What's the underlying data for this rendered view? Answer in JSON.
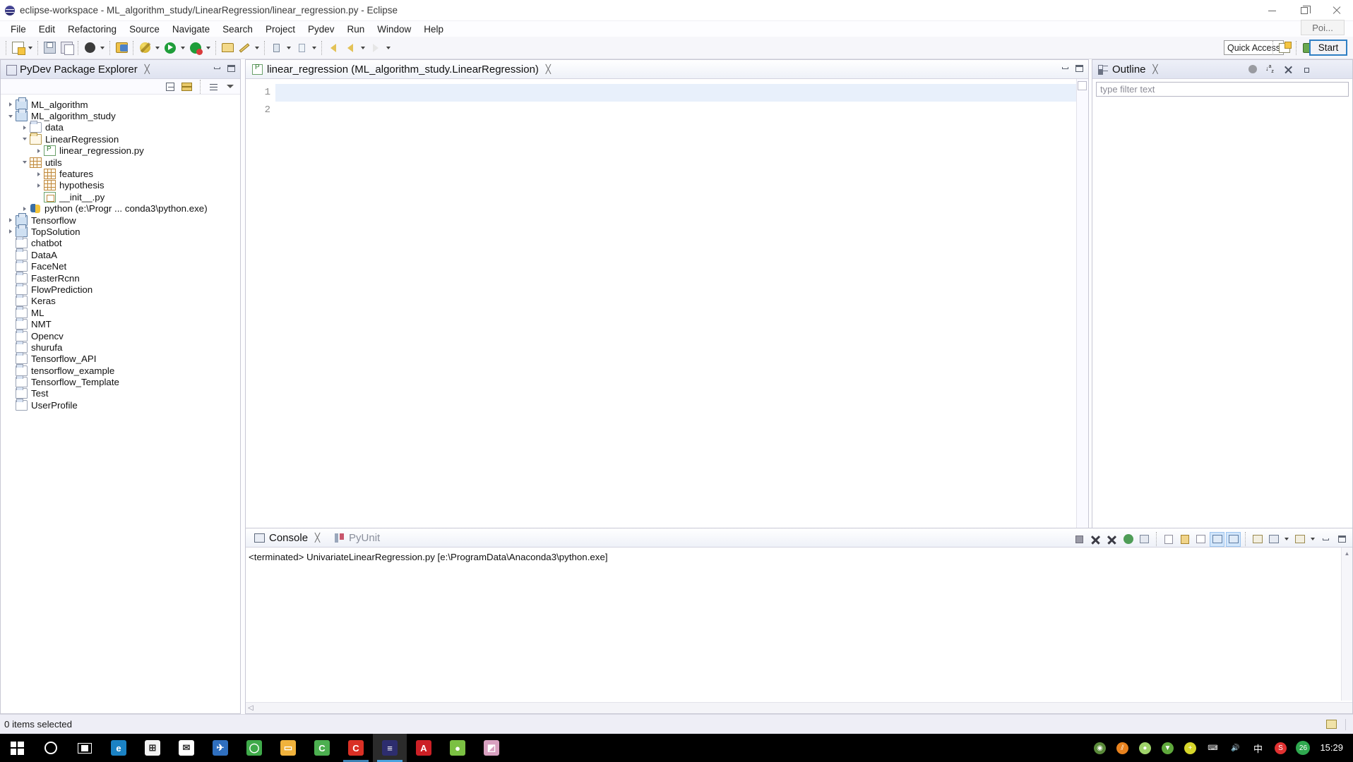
{
  "window": {
    "title": "eclipse-workspace - ML_algorithm_study/LinearRegression/linear_regression.py - Eclipse",
    "minimize_label": "Minimize",
    "restore_label": "Restore",
    "close_label": "Close"
  },
  "menubar": [
    {
      "label": "File"
    },
    {
      "label": "Edit"
    },
    {
      "label": "Refactoring"
    },
    {
      "label": "Source"
    },
    {
      "label": "Navigate"
    },
    {
      "label": "Search"
    },
    {
      "label": "Project"
    },
    {
      "label": "Pydev"
    },
    {
      "label": "Run"
    },
    {
      "label": "Window"
    },
    {
      "label": "Help"
    }
  ],
  "toolbar": {
    "quick_access_placeholder": "Quick Access",
    "buttons": [
      {
        "name": "new-wizard",
        "icon": "new-document-icon"
      },
      {
        "name": "save",
        "icon": "save-icon"
      },
      {
        "name": "save-all",
        "icon": "save-all-icon"
      },
      {
        "name": "toggle-comment",
        "icon": "black-circle-icon"
      },
      {
        "name": "pydev-package",
        "icon": "pydev-package-icon"
      },
      {
        "name": "debug",
        "icon": "debug-bug-icon"
      },
      {
        "name": "run",
        "icon": "run-play-icon"
      },
      {
        "name": "coverage",
        "icon": "coverage-icon"
      },
      {
        "name": "external-tools",
        "icon": "external-tools-icon"
      },
      {
        "name": "search",
        "icon": "search-pencil-icon"
      },
      {
        "name": "next-annotation",
        "icon": "arrow-down-icon"
      },
      {
        "name": "previous-annotation",
        "icon": "arrow-up-icon"
      },
      {
        "name": "back",
        "icon": "back-arrow-icon"
      },
      {
        "name": "forward",
        "icon": "forward-arrow-icon"
      }
    ],
    "perspective_buttons": [
      {
        "name": "open-perspective",
        "icon": "open-perspective-icon"
      },
      {
        "name": "pydev-perspective",
        "icon": "pydev-perspective-icon"
      },
      {
        "name": "debug-perspective",
        "icon": "debug-perspective-icon"
      }
    ]
  },
  "explorer": {
    "title": "PyDev Package Explorer",
    "icon": "package-explorer-icon",
    "toolbar": [
      {
        "name": "collapse-all",
        "icon": "collapse-all-icon"
      },
      {
        "name": "link-with-editor",
        "icon": "link-editor-icon"
      },
      {
        "name": "view-menu-sort",
        "icon": "sort-icon"
      },
      {
        "name": "view-menu",
        "icon": "chevron-down-icon"
      }
    ],
    "tree": [
      {
        "label": "ML_algorithm",
        "icon": "project-icon",
        "indent": 0,
        "twisty": "collapsed"
      },
      {
        "label": "ML_algorithm_study",
        "icon": "project-icon",
        "indent": 0,
        "twisty": "expanded"
      },
      {
        "label": "data",
        "icon": "folder-icon",
        "indent": 1,
        "twisty": "collapsed"
      },
      {
        "label": "LinearRegression",
        "icon": "source-folder-icon",
        "indent": 1,
        "twisty": "expanded"
      },
      {
        "label": "linear_regression.py",
        "icon": "python-file-icon",
        "indent": 2,
        "twisty": "collapsed"
      },
      {
        "label": "utils",
        "icon": "package-icon",
        "indent": 1,
        "twisty": "expanded"
      },
      {
        "label": "features",
        "icon": "package-icon",
        "indent": 2,
        "twisty": "collapsed"
      },
      {
        "label": "hypothesis",
        "icon": "package-icon",
        "indent": 2,
        "twisty": "collapsed"
      },
      {
        "label": "__init__.py",
        "icon": "init-file-icon",
        "indent": 2,
        "twisty": "none"
      },
      {
        "label": "python  (e:\\Progr ... conda3\\python.exe)",
        "icon": "python-interpreter-icon",
        "indent": 1,
        "twisty": "collapsed"
      },
      {
        "label": "Tensorflow",
        "icon": "project-icon",
        "indent": 0,
        "twisty": "collapsed"
      },
      {
        "label": "TopSolution",
        "icon": "project-icon",
        "indent": 0,
        "twisty": "collapsed"
      },
      {
        "label": "chatbot",
        "icon": "folder-icon",
        "indent": 0,
        "twisty": "none"
      },
      {
        "label": "DataA",
        "icon": "folder-icon",
        "indent": 0,
        "twisty": "none"
      },
      {
        "label": "FaceNet",
        "icon": "folder-icon",
        "indent": 0,
        "twisty": "none"
      },
      {
        "label": "FasterRcnn",
        "icon": "folder-icon",
        "indent": 0,
        "twisty": "none"
      },
      {
        "label": "FlowPrediction",
        "icon": "folder-icon",
        "indent": 0,
        "twisty": "none"
      },
      {
        "label": "Keras",
        "icon": "folder-icon",
        "indent": 0,
        "twisty": "none"
      },
      {
        "label": "ML",
        "icon": "folder-icon",
        "indent": 0,
        "twisty": "none"
      },
      {
        "label": "NMT",
        "icon": "folder-icon",
        "indent": 0,
        "twisty": "none"
      },
      {
        "label": "Opencv",
        "icon": "folder-icon",
        "indent": 0,
        "twisty": "none"
      },
      {
        "label": "shurufa",
        "icon": "folder-icon",
        "indent": 0,
        "twisty": "none"
      },
      {
        "label": "Tensorflow_API",
        "icon": "folder-icon",
        "indent": 0,
        "twisty": "none"
      },
      {
        "label": "tensorflow_example",
        "icon": "folder-icon",
        "indent": 0,
        "twisty": "none"
      },
      {
        "label": "Tensorflow_Template",
        "icon": "folder-icon",
        "indent": 0,
        "twisty": "none"
      },
      {
        "label": "Test",
        "icon": "folder-icon",
        "indent": 0,
        "twisty": "none"
      },
      {
        "label": "UserProfile",
        "icon": "folder-icon",
        "indent": 0,
        "twisty": "none"
      }
    ]
  },
  "editor": {
    "tab_label": "linear_regression (ML_algorithm_study.LinearRegression)",
    "tab_icon": "python-file-icon",
    "lines": [
      {
        "number": "1",
        "text": "",
        "current": true
      },
      {
        "number": "2",
        "text": "",
        "current": false
      }
    ]
  },
  "outline": {
    "title": "Outline",
    "icon": "outline-icon",
    "filter_placeholder": "type filter text",
    "tools": [
      {
        "name": "hide-fields",
        "icon": "hide-fields-icon"
      },
      {
        "name": "sort-alphabetically",
        "icon": "sort-az-icon"
      },
      {
        "name": "collapse-all",
        "icon": "collapse-all-icon"
      },
      {
        "name": "expand-all",
        "icon": "expand-all-icon"
      }
    ]
  },
  "overlay": {
    "tooltip_text": "Poi...",
    "start_button_label": "Start"
  },
  "console": {
    "tabs": [
      {
        "label": "Console",
        "icon": "console-icon",
        "active": true
      },
      {
        "label": "PyUnit",
        "icon": "pyunit-icon",
        "active": false
      }
    ],
    "output": "<terminated> UnivariateLinearRegression.py [e:\\ProgramData\\Anaconda3\\python.exe]",
    "tools": [
      {
        "name": "terminate",
        "icon": "terminate-icon",
        "on": false
      },
      {
        "name": "remove-launch",
        "icon": "remove-icon",
        "on": false
      },
      {
        "name": "remove-all-terminated",
        "icon": "remove-all-icon",
        "on": false
      },
      {
        "name": "relaunch",
        "icon": "relaunch-icon",
        "on": false
      },
      {
        "name": "copy-console",
        "icon": "copy-icon",
        "on": false
      },
      {
        "name": "clear-console",
        "icon": "clear-console-icon",
        "on": false
      },
      {
        "name": "scroll-lock",
        "icon": "lock-icon",
        "on": false
      },
      {
        "name": "word-wrap",
        "icon": "word-wrap-icon",
        "on": false
      },
      {
        "name": "show-console-on-output",
        "icon": "show-output-icon",
        "on": true
      },
      {
        "name": "show-console-on-error",
        "icon": "show-error-icon",
        "on": true
      },
      {
        "name": "pin-console",
        "icon": "pin-console-icon",
        "on": false
      },
      {
        "name": "display-selected-console",
        "icon": "display-console-icon",
        "on": false
      },
      {
        "name": "open-console",
        "icon": "new-console-icon",
        "on": false
      },
      {
        "name": "minimize-console",
        "icon": "minimize-icon",
        "on": false
      },
      {
        "name": "maximize-console",
        "icon": "maximize-icon",
        "on": false
      }
    ]
  },
  "statusbar": {
    "text": "0 items selected",
    "right_icon": "smiley-icon"
  },
  "taskbar": {
    "items": [
      {
        "name": "start-button",
        "icon": "windows-logo-icon",
        "color": "#ffffff",
        "glyph": ""
      },
      {
        "name": "cortana-search",
        "icon": "cortana-circle-icon",
        "color": "#ffffff",
        "glyph": ""
      },
      {
        "name": "task-view",
        "icon": "task-view-icon",
        "color": "#ffffff",
        "glyph": ""
      },
      {
        "name": "edge-browser",
        "icon": "edge-icon",
        "color": "#1b82c4",
        "glyph": "e"
      },
      {
        "name": "microsoft-store",
        "icon": "store-icon",
        "color": "#f2f2f2",
        "glyph": "⊞"
      },
      {
        "name": "mail",
        "icon": "mail-icon",
        "color": "#ffffff",
        "glyph": "✉"
      },
      {
        "name": "foxmail",
        "icon": "foxmail-icon",
        "color": "#2f6fbf",
        "glyph": "✈"
      },
      {
        "name": "browser-360",
        "icon": "green-browser-icon",
        "color": "#3faa4a",
        "glyph": "◯"
      },
      {
        "name": "file-explorer",
        "icon": "folder-icon",
        "color": "#f0b23c",
        "glyph": "▭"
      },
      {
        "name": "green-app",
        "icon": "green-app-icon",
        "color": "#4caf50",
        "glyph": "C"
      },
      {
        "name": "red-app",
        "icon": "red-app-icon",
        "color": "#d93025",
        "glyph": "C",
        "state": "open"
      },
      {
        "name": "eclipse-ide",
        "icon": "eclipse-icon",
        "color": "#2d2d6e",
        "glyph": "≡",
        "state": "active"
      },
      {
        "name": "acrobat-reader",
        "icon": "pdf-icon",
        "color": "#cc2026",
        "glyph": "A"
      },
      {
        "name": "wechat",
        "icon": "wechat-icon",
        "color": "#7bc043",
        "glyph": "●"
      },
      {
        "name": "photo-app",
        "icon": "photo-app-icon",
        "color": "#d8a0c0",
        "glyph": "◩"
      }
    ],
    "tray": [
      {
        "name": "nvidia-settings",
        "icon": "nvidia-icon",
        "color": "#5a8a3a",
        "glyph": "◉"
      },
      {
        "name": "orange-tray-app",
        "icon": "orange-app-icon",
        "color": "#e8821e",
        "glyph": "⫽"
      },
      {
        "name": "wechat-tray",
        "icon": "wechat-tray-icon",
        "color": "#9fd36a",
        "glyph": "●"
      },
      {
        "name": "security-shield",
        "icon": "shield-icon",
        "color": "#5fa83c",
        "glyph": "▼"
      },
      {
        "name": "update-plus",
        "icon": "plus-circle-icon",
        "color": "#d6d62a",
        "glyph": "+"
      },
      {
        "name": "network",
        "icon": "network-icon",
        "color": "#ffffff",
        "glyph": "⌨"
      },
      {
        "name": "volume",
        "icon": "volume-icon",
        "color": "#ffffff",
        "glyph": "🔊"
      },
      {
        "name": "ime-language",
        "icon": "ime-icon",
        "color": "#ffffff",
        "glyph": "中"
      },
      {
        "name": "sogou-input",
        "icon": "sogou-icon",
        "color": "#e03131",
        "glyph": "S"
      },
      {
        "name": "battery-badge",
        "icon": "badge-icon",
        "color": "#2fa84f",
        "glyph": "26"
      }
    ],
    "clock": "15:29"
  }
}
